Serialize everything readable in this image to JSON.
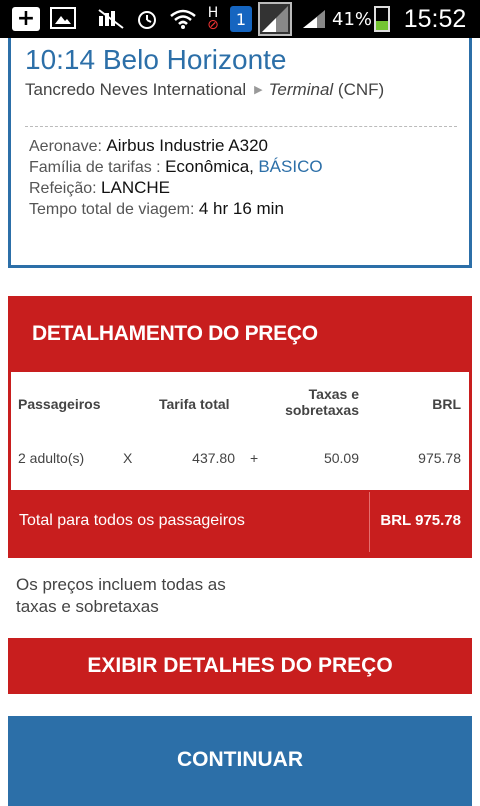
{
  "status_bar": {
    "icons": [
      "add-icon",
      "photo-icon",
      "mute-icon",
      "alarm-icon",
      "wifi-icon",
      "hspa-icon",
      "sim-icon",
      "signal-icon"
    ],
    "sim_number": "1",
    "h_label": "H",
    "battery_percent": "41%",
    "time": "15:52"
  },
  "flight": {
    "arrival": "10:14 Belo Horizonte",
    "airport": "Tancredo Neves International",
    "terminal_label": "Terminal",
    "airport_code": "(CNF)",
    "aircraft_label": "Aeronave:",
    "aircraft_value": "Airbus Industrie A320",
    "fare_family_label": "Família de tarifas :",
    "fare_family_value": "Econômica,",
    "fare_family_link": "BÁSICO",
    "meal_label": "Refeição:",
    "meal_value": "LANCHE",
    "duration_label": "Tempo total de viagem:",
    "duration_value": "4 hr 16 min"
  },
  "price": {
    "title": "DETALHAMENTO DO PREÇO",
    "headers": {
      "passengers": "Passageiros",
      "fare_total": "Tarifa total",
      "taxes_line1": "Taxas e",
      "taxes_line2": "sobretaxas",
      "currency": "BRL"
    },
    "row": {
      "passengers": "2 adulto(s)",
      "times": "X",
      "fare": "437.80",
      "plus": "+",
      "taxes": "50.09",
      "total": "975.78"
    },
    "total_label": "Total para todos os passageiros",
    "total_value": "BRL 975.78"
  },
  "note": "Os preços incluem todas as taxas e sobretaxas",
  "buttons": {
    "details": "EXIBIR DETALHES DO PREÇO",
    "continue": "CONTINUAR"
  },
  "colors": {
    "accent_blue": "#2c6fa8",
    "accent_red": "#c81e1e"
  }
}
